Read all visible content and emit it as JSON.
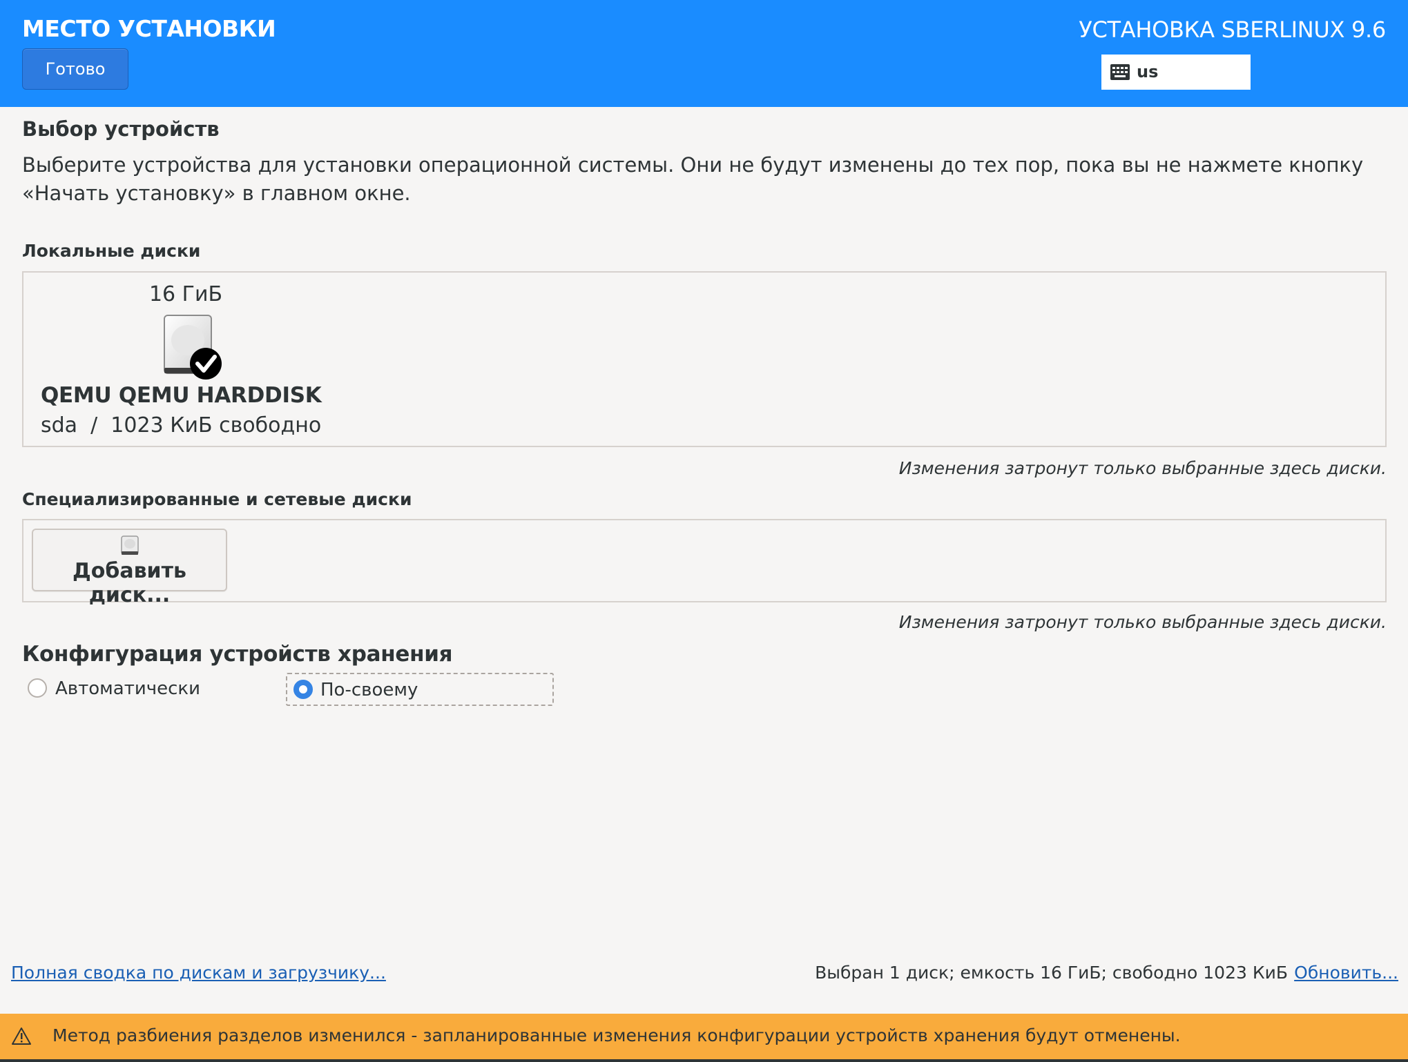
{
  "header": {
    "title": "МЕСТО УСТАНОВКИ",
    "done_label": "Готово",
    "product": "УСТАНОВКА SBERLINUX 9.6",
    "keyboard_layout": "us",
    "keyboard_icon": "keyboard-icon",
    "background_color": "#1a8cff"
  },
  "device_selection": {
    "title": "Выбор устройств",
    "description": "Выберите устройства для установки операционной системы. Они не будут изменены до тех пор, пока вы не нажмете кнопку «Начать установку» в главном окне."
  },
  "local_disks": {
    "label": "Локальные диски",
    "disks": [
      {
        "size": "16 ГиБ",
        "model": "QEMU QEMU HARDDISK",
        "info": "sda  /  1023 КиБ свободно",
        "selected": true,
        "icon": "harddisk-selected-icon"
      }
    ],
    "hint": "Изменения затронут только выбранные здесь диски."
  },
  "specialized_disks": {
    "label": "Специализированные и сетевые диски",
    "add_button_label": "Добавить диск...",
    "add_button_icon": "harddisk-icon",
    "hint": "Изменения затронут только выбранные здесь диски."
  },
  "storage_config": {
    "title": "Конфигурация устройств хранения",
    "options": [
      {
        "label": "Автоматически",
        "selected": false
      },
      {
        "label": "По-своему",
        "selected": true
      }
    ]
  },
  "footer": {
    "summary_link": "Полная сводка по дискам и загрузчику...",
    "summary_text": "Выбран 1 диск; емкость 16 ГиБ; свободно 1023 КиБ",
    "refresh_link": "Обновить..."
  },
  "warning": {
    "icon": "warning-icon",
    "text": "Метод разбиения разделов изменился - запланированные изменения конфигурации устройств хранения будут отменены.",
    "color": "#f9ab3c"
  }
}
